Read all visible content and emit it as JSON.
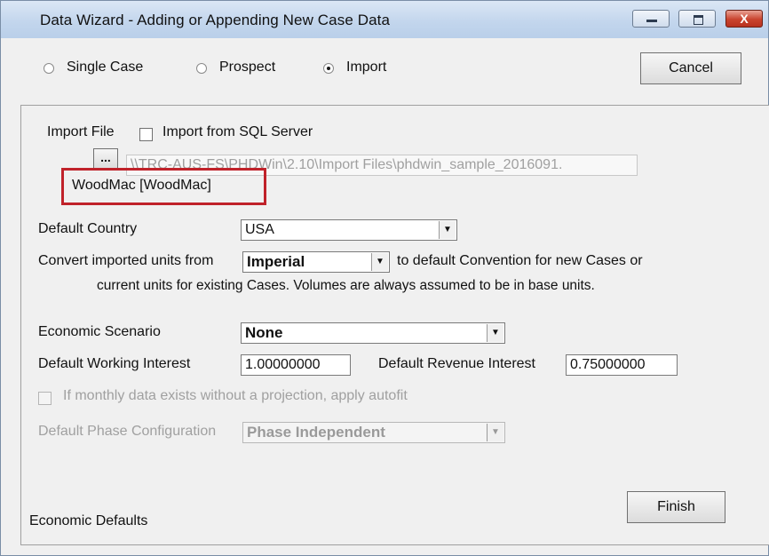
{
  "window": {
    "title": "Data Wizard - Adding or Appending New Case Data",
    "close_glyph": "X"
  },
  "mode": {
    "options": [
      {
        "label": "Single Case",
        "selected": false
      },
      {
        "label": "Prospect",
        "selected": false
      },
      {
        "label": "Import",
        "selected": true
      }
    ]
  },
  "buttons": {
    "cancel": "Cancel",
    "finish": "Finish",
    "browse": "..."
  },
  "import": {
    "file_label": "Import File",
    "sql_checkbox_label": "Import from SQL Server",
    "sql_checked": false,
    "path": "\\\\TRC-AUS-FS\\PHDWin\\2.10\\Import Files\\phdwin_sample_2016091.",
    "source": "WoodMac [WoodMac]"
  },
  "country": {
    "label": "Default Country",
    "value": "USA"
  },
  "units": {
    "label": "Convert imported units from",
    "value": "Imperial",
    "suffix": "to default Convention for new Cases or",
    "note": "current units for existing Cases. Volumes are always assumed to be in base units."
  },
  "economic": {
    "scenario_label": "Economic Scenario",
    "scenario_value": "None",
    "wi_label": "Default Working Interest",
    "wi_value": "1.00000000",
    "ri_label": "Default Revenue Interest",
    "ri_value": "0.75000000"
  },
  "autofit": {
    "label": "If monthly data exists without a projection, apply autofit",
    "checked": false,
    "enabled": false
  },
  "phase": {
    "label": "Default Phase Configuration",
    "value": "Phase Independent",
    "enabled": false
  },
  "footer": {
    "economic_defaults": "Economic Defaults"
  },
  "colors": {
    "highlight_border": "#c0222a",
    "titlebar": "#c3d6ed",
    "close_button": "#c9432e"
  },
  "icons": [
    "minimize-icon",
    "maximize-icon",
    "close-icon"
  ]
}
